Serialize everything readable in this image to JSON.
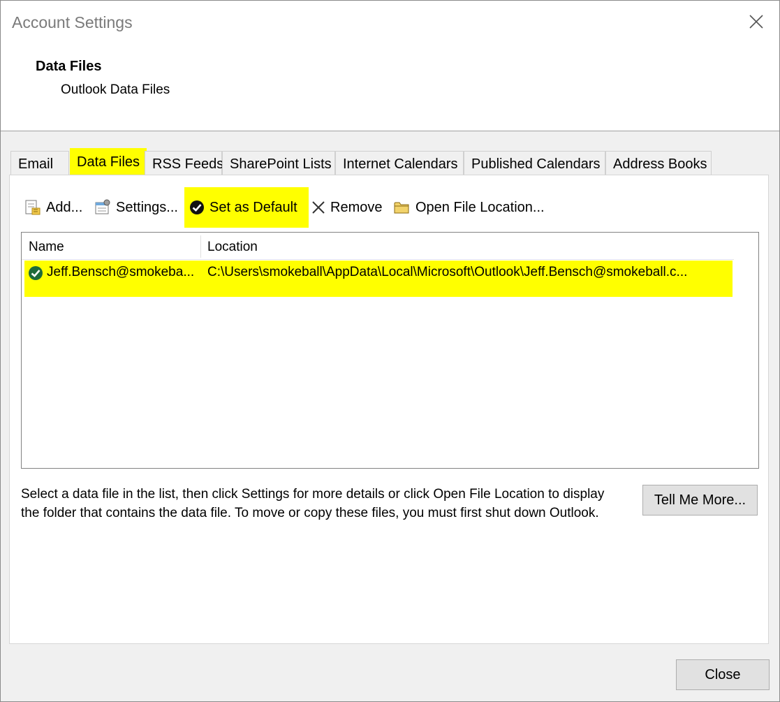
{
  "window": {
    "title": "Account Settings"
  },
  "header": {
    "section_title": "Data Files",
    "section_subtitle": "Outlook Data Files"
  },
  "tabs": [
    {
      "label": "Email"
    },
    {
      "label": "Data Files"
    },
    {
      "label": "RSS Feeds"
    },
    {
      "label": "SharePoint Lists"
    },
    {
      "label": "Internet Calendars"
    },
    {
      "label": "Published Calendars"
    },
    {
      "label": "Address Books"
    }
  ],
  "toolbar": {
    "add": "Add...",
    "settings": "Settings...",
    "set_default": "Set as Default",
    "remove": "Remove",
    "open_location": "Open File Location..."
  },
  "list": {
    "columns": {
      "name": "Name",
      "location": "Location"
    },
    "rows": [
      {
        "name": "Jeff.Bensch@smokeba...",
        "location": "C:\\Users\\smokeball\\AppData\\Local\\Microsoft\\Outlook\\Jeff.Bensch@smokeball.c..."
      }
    ]
  },
  "info_text": "Select a data file in the list, then click Settings for more details or click Open File Location to display the folder that contains the data file. To move or copy these files, you must first shut down Outlook.",
  "buttons": {
    "tell_me_more": "Tell Me More...",
    "close": "Close"
  },
  "colors": {
    "highlight": "#ffff00"
  }
}
